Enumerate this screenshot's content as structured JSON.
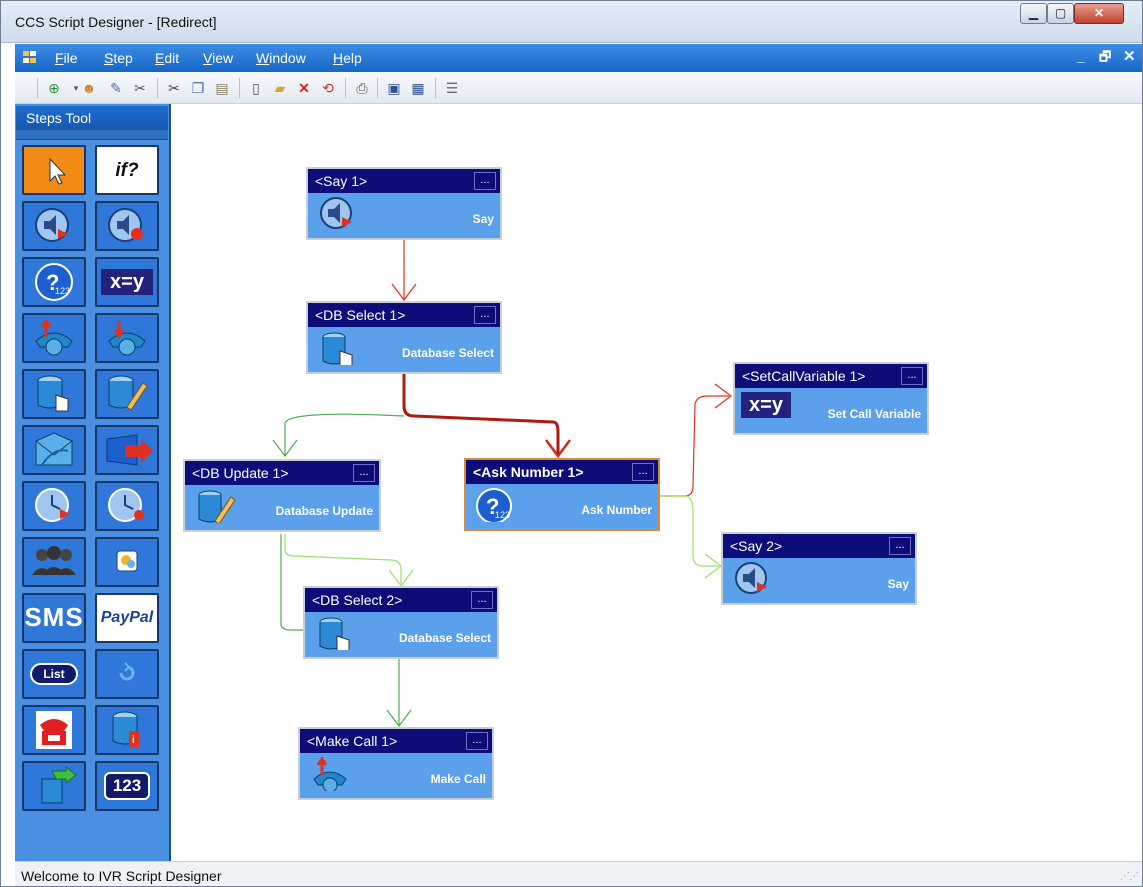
{
  "window": {
    "title": "CCS Script Designer - [Redirect]"
  },
  "menu": {
    "items": [
      {
        "label": "File",
        "accel": "F",
        "rest": "ile"
      },
      {
        "label": "Step",
        "accel": "S",
        "rest": "tep"
      },
      {
        "label": "Edit",
        "accel": "E",
        "rest": "dit"
      },
      {
        "label": "View",
        "accel": "V",
        "rest": "iew"
      },
      {
        "label": "Window",
        "accel": "W",
        "rest": "indow"
      },
      {
        "label": "Help",
        "accel": "H",
        "rest": "elp"
      }
    ]
  },
  "toolbar": {
    "buttons": [
      "new-step-icon",
      "user-icon",
      "edit-icon",
      "tools-icon",
      "cut-icon",
      "copy-icon",
      "paste-icon",
      "new-document-icon",
      "open-folder-icon",
      "delete-icon",
      "refresh-icon",
      "print-icon",
      "save-icon",
      "save-all-icon",
      "properties-icon"
    ]
  },
  "steps_tool": {
    "title": "Steps Tool",
    "tools": [
      {
        "name": "pointer-tool",
        "icon": "pointer-icon"
      },
      {
        "name": "if-tool",
        "icon": "if-icon",
        "text": "if?"
      },
      {
        "name": "say-tool",
        "icon": "speaker-icon"
      },
      {
        "name": "record-tool",
        "icon": "record-icon"
      },
      {
        "name": "ask-number-tool",
        "icon": "ask-number-icon"
      },
      {
        "name": "set-variable-tool",
        "icon": "set-variable-icon",
        "text": "x=y"
      },
      {
        "name": "make-call-tool",
        "icon": "outgoing-call-icon"
      },
      {
        "name": "transfer-call-tool",
        "icon": "incoming-call-icon"
      },
      {
        "name": "database-select-tool",
        "icon": "database-select-icon"
      },
      {
        "name": "database-update-tool",
        "icon": "database-update-icon"
      },
      {
        "name": "email-tool",
        "icon": "email-icon"
      },
      {
        "name": "redirect-tool",
        "icon": "redirect-icon"
      },
      {
        "name": "play-time-tool",
        "icon": "clock-play-icon"
      },
      {
        "name": "record-time-tool",
        "icon": "clock-record-icon"
      },
      {
        "name": "conference-tool",
        "icon": "conference-icon"
      },
      {
        "name": "chat-tool",
        "icon": "chat-icon"
      },
      {
        "name": "sms-tool",
        "icon": "sms-icon",
        "text": "SMS"
      },
      {
        "name": "paypal-tool",
        "icon": "paypal-icon",
        "text": "PayPal"
      },
      {
        "name": "list-tool",
        "icon": "list-icon",
        "text": "List"
      },
      {
        "name": "loop-tool",
        "icon": "loop-icon"
      },
      {
        "name": "hangup-tool",
        "icon": "phone-icon"
      },
      {
        "name": "database-info-tool",
        "icon": "database-info-icon"
      },
      {
        "name": "goto-tool",
        "icon": "goto-icon"
      },
      {
        "name": "number-tool",
        "icon": "number-icon",
        "text": "123"
      }
    ]
  },
  "canvas": {
    "nodes": [
      {
        "id": "say1",
        "title": "<Say 1>",
        "label": "Say",
        "icon": "speaker-icon"
      },
      {
        "id": "dbselect1",
        "title": "<DB Select 1>",
        "label": "Database Select",
        "icon": "database-select-icon"
      },
      {
        "id": "setcallvar1",
        "title": "<SetCallVariable 1>",
        "label": "Set Call Variable",
        "icon": "set-variable-icon"
      },
      {
        "id": "dbupdate1",
        "title": "<DB Update 1>",
        "label": "Database Update",
        "icon": "database-update-icon"
      },
      {
        "id": "asknumber1",
        "title": "<Ask Number 1>",
        "label": "Ask Number",
        "icon": "ask-number-icon",
        "selected": true
      },
      {
        "id": "say2",
        "title": "<Say 2>",
        "label": "Say",
        "icon": "speaker-icon"
      },
      {
        "id": "dbselect2",
        "title": "<DB Select 2>",
        "label": "Database Select",
        "icon": "database-select-icon"
      },
      {
        "id": "makecall1",
        "title": "<Make Call 1>",
        "label": "Make Call",
        "icon": "outgoing-call-icon"
      }
    ],
    "options_button": "...",
    "colors": {
      "node_header": "#0d0d7a",
      "node_body": "#5aa0ea",
      "link_red": "#e53020",
      "link_green": "#4caf50",
      "link_light_green": "#9be06a",
      "link_dark_red": "#8b1a10"
    }
  },
  "statusbar": {
    "text": "Welcome to IVR Script Designer"
  }
}
